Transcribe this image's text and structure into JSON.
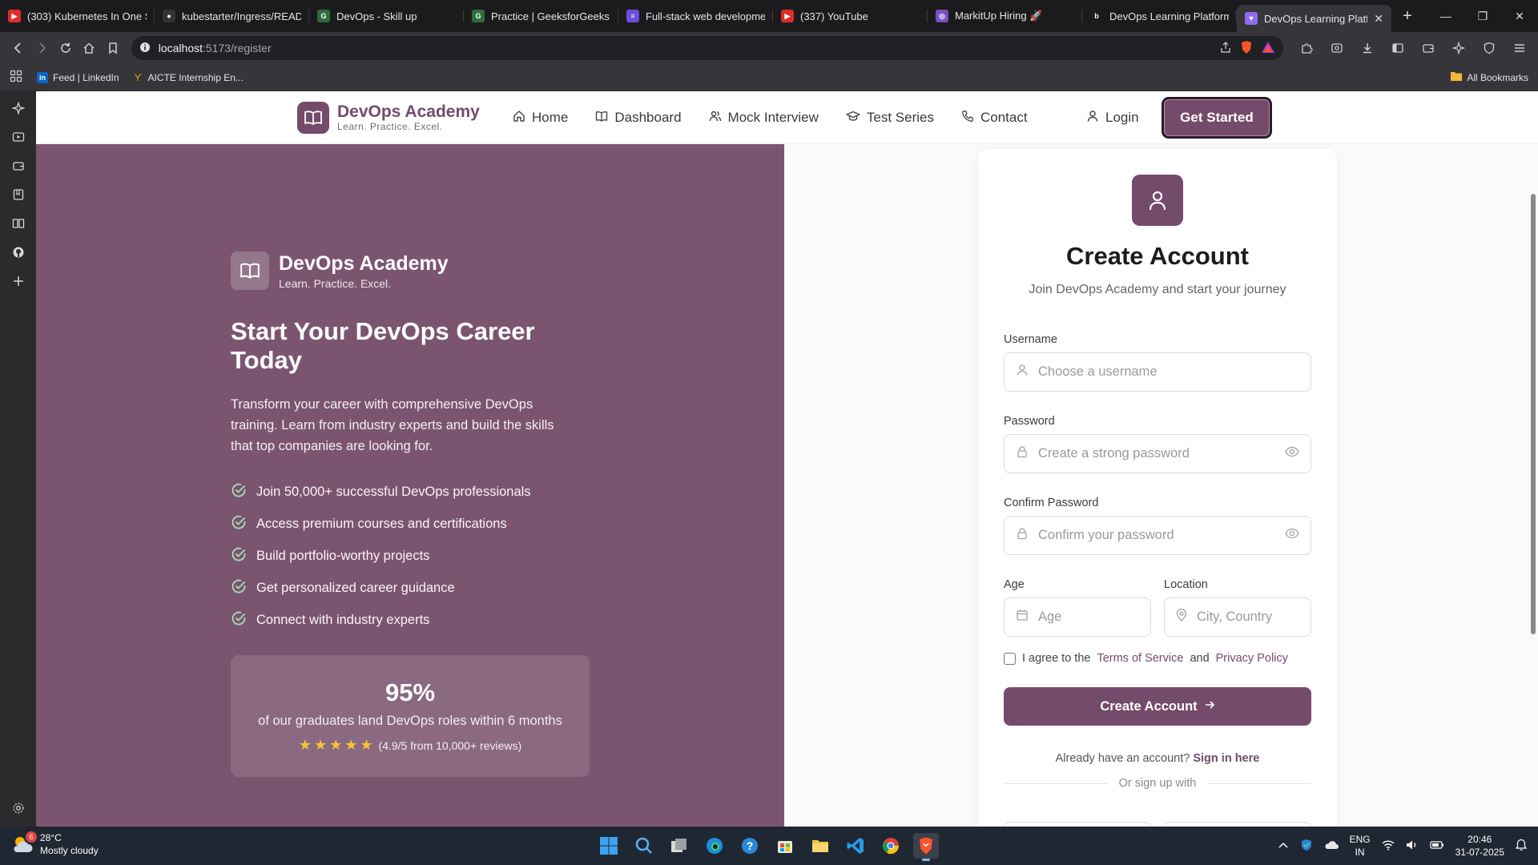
{
  "browser": {
    "tabs": [
      {
        "title": "(303) Kubernetes In One S",
        "fav_color": "#e02b2b",
        "fav_glyph": "▶",
        "active": false
      },
      {
        "title": "kubestarter/Ingress/READI",
        "fav_color": "#333333",
        "fav_glyph": "●",
        "active": false
      },
      {
        "title": "DevOps - Skill up",
        "fav_color": "#2f6b3b",
        "fav_glyph": "G",
        "active": false
      },
      {
        "title": "Practice | GeeksforGeeks |",
        "fav_color": "#2f6b3b",
        "fav_glyph": "G",
        "active": false
      },
      {
        "title": "Full-stack web developme",
        "fav_color": "#6a4fd8",
        "fav_glyph": "≡",
        "active": false
      },
      {
        "title": "(337) YouTube",
        "fav_color": "#e02b2b",
        "fav_glyph": "▶",
        "active": false
      },
      {
        "title": "MarkitUp Hiring 🚀",
        "fav_color": "#7a4fc0",
        "fav_glyph": "◎",
        "active": false
      },
      {
        "title": "DevOps Learning Platform",
        "fav_color": "#1b1b1d",
        "fav_glyph": "b",
        "active": false
      },
      {
        "title": "DevOps Learning Platf",
        "fav_color": "#8e6cf0",
        "fav_glyph": "▼",
        "active": true
      }
    ],
    "url_host": "localhost",
    "url_path": ":5173/register",
    "bookmarks": [
      {
        "label": "Feed | LinkedIn",
        "icon": "linkedin-icon"
      },
      {
        "label": "AICTE Internship En...",
        "icon": "aicte-icon"
      }
    ],
    "all_bookmarks": "All Bookmarks"
  },
  "site": {
    "brand_name": "DevOps Academy",
    "brand_tag": "Learn. Practice. Excel.",
    "nav": [
      {
        "label": "Home",
        "icon": "home-icon"
      },
      {
        "label": "Dashboard",
        "icon": "book-icon"
      },
      {
        "label": "Mock Interview",
        "icon": "users-icon"
      },
      {
        "label": "Test Series",
        "icon": "graduation-cap-icon"
      },
      {
        "label": "Contact",
        "icon": "phone-icon"
      }
    ],
    "login": "Login",
    "get_started": "Get Started",
    "accent": "#744b6b"
  },
  "hero": {
    "brand_name": "DevOps Academy",
    "brand_tag": "Learn. Practice. Excel.",
    "title": "Start Your DevOps Career Today",
    "description": "Transform your career with comprehensive DevOps training. Learn from industry experts and build the skills that top companies are looking for.",
    "features": [
      "Join 50,000+ successful DevOps professionals",
      "Access premium courses and certifications",
      "Build portfolio-worthy projects",
      "Get personalized career guidance",
      "Connect with industry experts"
    ],
    "stat_value": "95%",
    "stat_text": "of our graduates land DevOps roles within 6 months",
    "rating_text": "(4.9/5 from 10,000+ reviews)",
    "stars": 5,
    "bg_color": "#7b5570"
  },
  "form": {
    "title": "Create Account",
    "subtitle": "Join DevOps Academy and start your journey",
    "username_label": "Username",
    "username_placeholder": "Choose a username",
    "password_label": "Password",
    "password_placeholder": "Create a strong password",
    "confirm_label": "Confirm Password",
    "confirm_placeholder": "Confirm your password",
    "age_label": "Age",
    "age_placeholder": "Age",
    "location_label": "Location",
    "location_placeholder": "City, Country",
    "agree_prefix": "I agree to the",
    "terms": "Terms of Service",
    "and": "and",
    "privacy": "Privacy Policy",
    "submit": "Create Account",
    "have_account": "Already have an account?",
    "sign_in": "Sign in here",
    "or_signup": "Or sign up with"
  },
  "taskbar": {
    "temperature": "28°C",
    "weather": "Mostly cloudy",
    "notif_count": "6",
    "lang_top": "ENG",
    "lang_bottom": "IN",
    "time": "20:46",
    "date": "31-07-2025"
  }
}
